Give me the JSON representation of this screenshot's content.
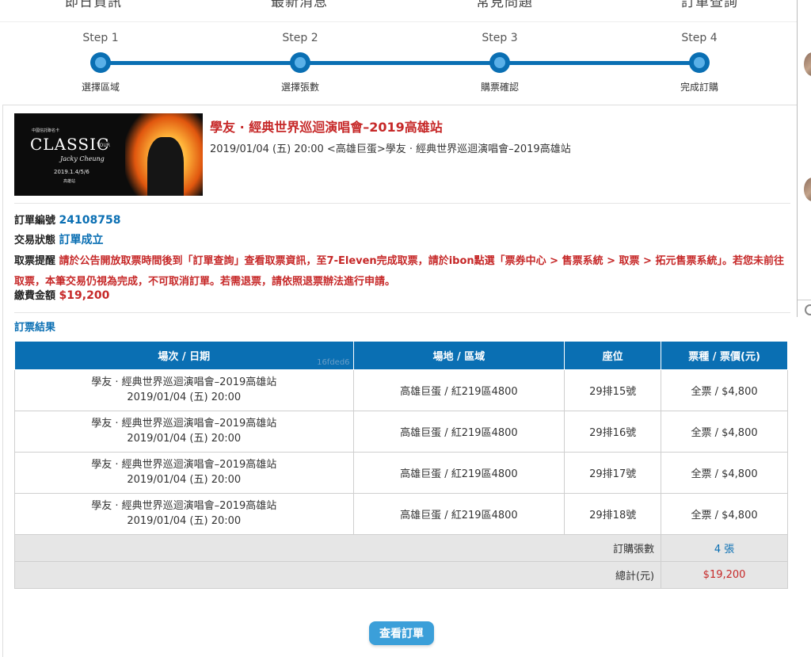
{
  "nav": {
    "items": [
      "即日資訊",
      "最新消息",
      "常見問題",
      "訂單查詢"
    ]
  },
  "steps": [
    {
      "title": "Step 1",
      "label": "選擇區域"
    },
    {
      "title": "Step 2",
      "label": "選擇張數"
    },
    {
      "title": "Step 3",
      "label": "購票確認"
    },
    {
      "title": "Step 4",
      "label": "完成訂購"
    }
  ],
  "event": {
    "title": "學友 · 經典世界巡迴演唱會–2019高雄站",
    "subtitle": "2019/01/04 (五) 20:00 <高雄巨蛋>學友 · 經典世界巡迴演唱會–2019高雄站",
    "poster": {
      "top_text": "中國信託聯名卡",
      "brand": "CLASSIC",
      "tour": "TOUR",
      "script": "Jacky Cheung",
      "date": "2019.1.4/5/6",
      "city": "高雄站"
    }
  },
  "order": {
    "number_label": "訂單編號",
    "number": "24108758",
    "status_label": "交易狀態",
    "status": "訂單成立",
    "reminder_label": "取票提醒",
    "reminder": "請於公告開放取票時間後到「訂單查詢」查看取票資訊，至7-Eleven完成取票，請於ibon點選「票券中心 > 售票系統 > 取票 > 拓元售票系統」。若您未前往取票，本筆交易仍視為完成，不可取消訂單。若需退票，請依照退票辦法進行申請。",
    "amount_label": "繳費金額",
    "amount": "$19,200"
  },
  "results": {
    "title": "訂票結果",
    "headers": [
      "場次 / 日期",
      "場地 / 區域",
      "座位",
      "票種 / 票價(元)"
    ],
    "watermark": "16fded6",
    "rows": [
      {
        "name": "學友 · 經典世界巡迴演唱會–2019高雄站",
        "date": "2019/01/04 (五) 20:00",
        "venue": "高雄巨蛋 / 紅219區4800",
        "seat": "29排15號",
        "price": "全票 / $4,800"
      },
      {
        "name": "學友 · 經典世界巡迴演唱會–2019高雄站",
        "date": "2019/01/04 (五) 20:00",
        "venue": "高雄巨蛋 / 紅219區4800",
        "seat": "29排16號",
        "price": "全票 / $4,800"
      },
      {
        "name": "學友 · 經典世界巡迴演唱會–2019高雄站",
        "date": "2019/01/04 (五) 20:00",
        "venue": "高雄巨蛋 / 紅219區4800",
        "seat": "29排17號",
        "price": "全票 / $4,800"
      },
      {
        "name": "學友 · 經典世界巡迴演唱會–2019高雄站",
        "date": "2019/01/04 (五) 20:00",
        "venue": "高雄巨蛋 / 紅219區4800",
        "seat": "29排18號",
        "price": "全票 / $4,800"
      }
    ],
    "count_label": "訂購張數",
    "count": "4 張",
    "total_label": "總計(元)",
    "total": "$19,200"
  },
  "buttons": {
    "view_order": "查看訂單"
  },
  "colors": {
    "primary": "#0a6fb3",
    "alert": "#c62828",
    "button": "#3b9fd9"
  }
}
